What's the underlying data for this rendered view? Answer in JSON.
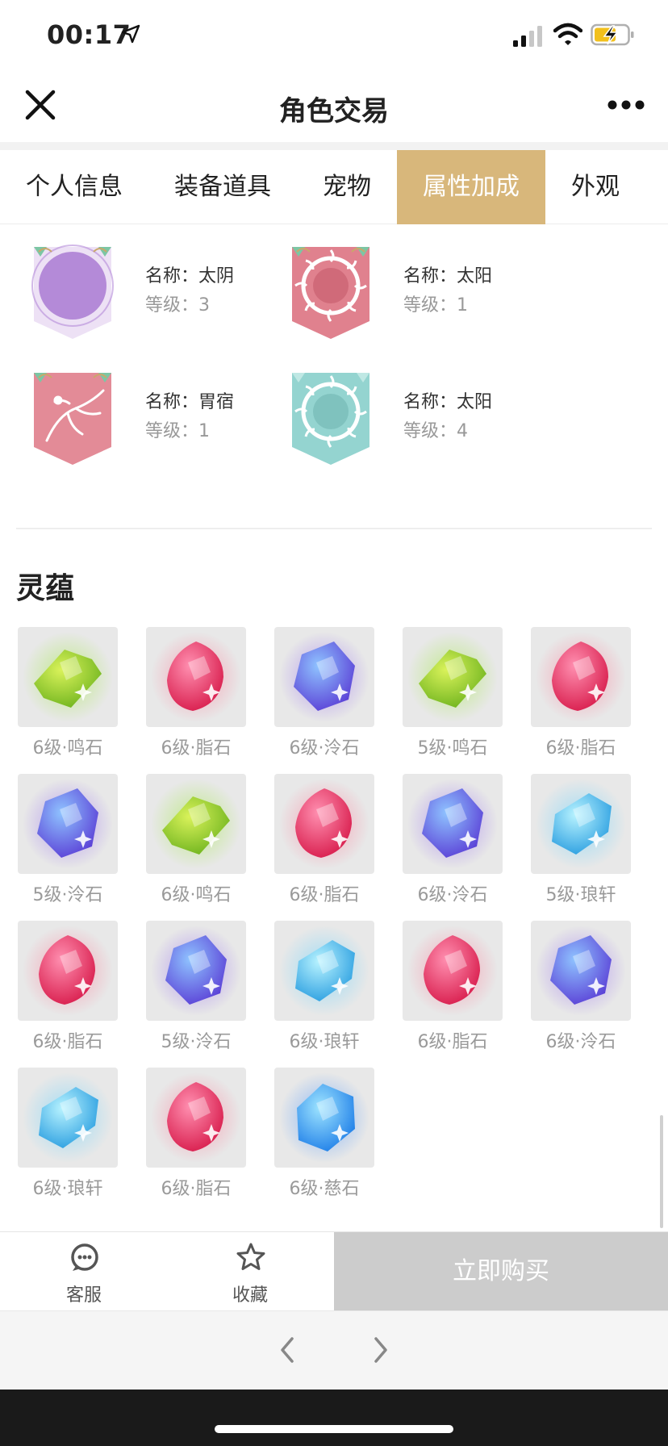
{
  "status_bar": {
    "time": "00:17"
  },
  "nav": {
    "title": "角色交易"
  },
  "tabs": [
    {
      "label": "个人信息"
    },
    {
      "label": "装备道具"
    },
    {
      "label": "宠物"
    },
    {
      "label": "属性加成",
      "active": true
    },
    {
      "label": "外观"
    }
  ],
  "attributes": [
    {
      "name": "名称：太阴",
      "level": "等级：3",
      "icon": "moon-emblem-icon",
      "color": "#b48ad8"
    },
    {
      "name": "名称：太阳",
      "level": "等级：1",
      "icon": "sun-emblem-icon",
      "color": "#e0818e"
    },
    {
      "name": "名称：胃宿",
      "level": "等级：1",
      "icon": "phoenix-emblem-icon",
      "color": "#e38b97"
    },
    {
      "name": "名称：太阳",
      "level": "等级：4",
      "icon": "sun-emblem-icon",
      "color": "#94d4d0"
    }
  ],
  "section": {
    "title": "灵蕴"
  },
  "gems": [
    {
      "label": "6级·鸣石",
      "type": "green"
    },
    {
      "label": "6级·脂石",
      "type": "red"
    },
    {
      "label": "6级·泠石",
      "type": "purple"
    },
    {
      "label": "5级·鸣石",
      "type": "green"
    },
    {
      "label": "6级·脂石",
      "type": "red"
    },
    {
      "label": "5级·泠石",
      "type": "purple"
    },
    {
      "label": "6级·鸣石",
      "type": "green"
    },
    {
      "label": "6级·脂石",
      "type": "red"
    },
    {
      "label": "6级·泠石",
      "type": "purple"
    },
    {
      "label": "5级·琅轩",
      "type": "cyan"
    },
    {
      "label": "6级·脂石",
      "type": "red"
    },
    {
      "label": "5级·泠石",
      "type": "purple"
    },
    {
      "label": "6级·琅轩",
      "type": "cyan"
    },
    {
      "label": "6级·脂石",
      "type": "red"
    },
    {
      "label": "6级·泠石",
      "type": "purple"
    },
    {
      "label": "6级·琅轩",
      "type": "cyan"
    },
    {
      "label": "6级·脂石",
      "type": "red"
    },
    {
      "label": "6级·慈石",
      "type": "blue"
    }
  ],
  "gem_colors": {
    "green": {
      "light": "#d9f25a",
      "dark": "#6fb41e",
      "glow": "#9ce83a"
    },
    "red": {
      "light": "#ff8fb0",
      "dark": "#d81c4c",
      "glow": "#ff6b8a"
    },
    "purple": {
      "light": "#8fc3ff",
      "dark": "#5a3fd6",
      "glow": "#8a5cf0"
    },
    "cyan": {
      "light": "#b8f3ff",
      "dark": "#2a9ee0",
      "glow": "#5ed0ff"
    },
    "blue": {
      "light": "#9ee4ff",
      "dark": "#1f7fe8",
      "glow": "#3a8cff"
    }
  },
  "actions": {
    "service_label": "客服",
    "favorite_label": "收藏",
    "buy_label": "立即购买"
  },
  "colors": {
    "tab_active_bg": "#d8b77b",
    "buy_button_bg": "#cccccc"
  }
}
